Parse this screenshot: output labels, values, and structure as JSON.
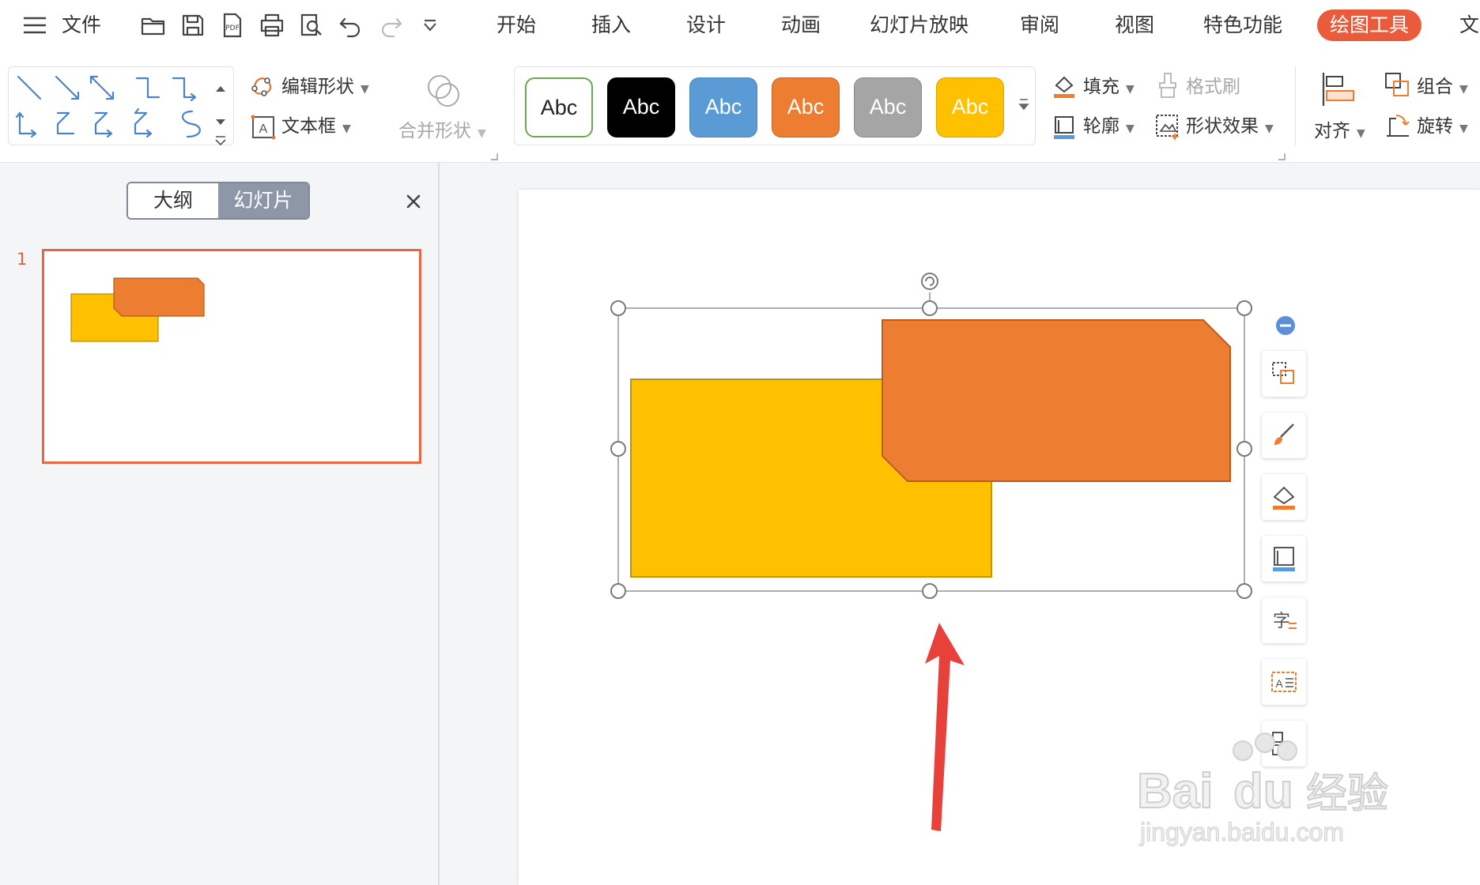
{
  "menu": {
    "hamburger": "≡",
    "file": "文件",
    "tabs": [
      "开始",
      "插入",
      "设计",
      "动画",
      "幻灯片放映",
      "审阅",
      "视图",
      "特色功能",
      "绘图工具",
      "文"
    ],
    "active_tab": "绘图工具"
  },
  "ribbon": {
    "edit_shape": "编辑形状",
    "text_box": "文本框",
    "merge_shapes": "合并形状",
    "style_chips": [
      {
        "label": "Abc",
        "bg": "#ffffff",
        "fg": "#222222",
        "border": "#6aa84f"
      },
      {
        "label": "Abc",
        "bg": "#000000",
        "fg": "#ffffff",
        "border": "#000000"
      },
      {
        "label": "Abc",
        "bg": "#5b9bd5",
        "fg": "#ffffff",
        "border": "#4a84b8"
      },
      {
        "label": "Abc",
        "bg": "#ed7d31",
        "fg": "#ffffff",
        "border": "#c5622a"
      },
      {
        "label": "Abc",
        "bg": "#a5a5a5",
        "fg": "#ffffff",
        "border": "#888888"
      },
      {
        "label": "Abc",
        "bg": "#ffc000",
        "fg": "#ffffff",
        "border": "#d9a400"
      }
    ],
    "fill": "填充",
    "format_painter": "格式刷",
    "outline": "轮廓",
    "shape_effects": "形状效果",
    "align": "对齐",
    "group": "组合",
    "rotate": "旋转"
  },
  "left_panel": {
    "tab_outline": "大纲",
    "tab_slides": "幻灯片",
    "active_tab": "幻灯片",
    "slide_number": "1"
  },
  "shapes": {
    "yellow_fill": "#ffc000",
    "orange_fill": "#ed7d31",
    "selection_state": "two shapes selected"
  },
  "annotation": {
    "arrow_color": "#e8413c"
  },
  "watermark": {
    "brand": "Bai du 经验",
    "url": "jingyan.baidu.com"
  },
  "colors": {
    "accent": "#ea5b3b",
    "panel_bg": "#f4f5f7"
  }
}
